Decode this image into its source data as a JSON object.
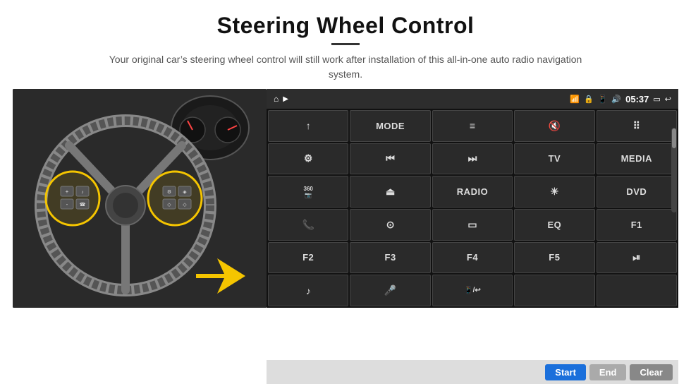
{
  "header": {
    "title": "Steering Wheel Control",
    "subtitle": "Your original car’s steering wheel control will still work after installation of this all-in-one auto radio navigation system."
  },
  "status_bar": {
    "icon_home": "⌂",
    "icon_wifi": "▲",
    "icon_lock": "🔒",
    "icon_sim": "📶",
    "icon_bt": "✿",
    "time": "05:37",
    "icon_screen": "□",
    "icon_back": "↩"
  },
  "buttons": [
    {
      "id": "b1",
      "type": "icon",
      "icon": "↑",
      "label": "nav-up"
    },
    {
      "id": "b2",
      "type": "text",
      "text": "MODE"
    },
    {
      "id": "b3",
      "type": "icon",
      "icon": "☰",
      "label": "menu"
    },
    {
      "id": "b4",
      "type": "icon",
      "icon": "🔇",
      "label": "mute"
    },
    {
      "id": "b5",
      "type": "icon",
      "icon": "…",
      "label": "apps"
    },
    {
      "id": "b6",
      "type": "icon",
      "icon": "⚙",
      "label": "settings"
    },
    {
      "id": "b7",
      "type": "icon",
      "icon": "⏮",
      "label": "prev"
    },
    {
      "id": "b8",
      "type": "icon",
      "icon": "⏭",
      "label": "next"
    },
    {
      "id": "b9",
      "type": "text",
      "text": "TV"
    },
    {
      "id": "b10",
      "type": "text",
      "text": "MEDIA"
    },
    {
      "id": "b11",
      "type": "icon",
      "icon": "📷",
      "label": "360cam"
    },
    {
      "id": "b12",
      "type": "icon",
      "icon": "⏫",
      "label": "eject"
    },
    {
      "id": "b13",
      "type": "text",
      "text": "RADIO"
    },
    {
      "id": "b14",
      "type": "icon",
      "icon": "☀",
      "label": "brightness"
    },
    {
      "id": "b15",
      "type": "text",
      "text": "DVD"
    },
    {
      "id": "b16",
      "type": "icon",
      "icon": "📞",
      "label": "phone"
    },
    {
      "id": "b17",
      "type": "icon",
      "icon": "☉",
      "label": "navi"
    },
    {
      "id": "b18",
      "type": "icon",
      "icon": "▭",
      "label": "mirror"
    },
    {
      "id": "b19",
      "type": "text",
      "text": "EQ"
    },
    {
      "id": "b20",
      "type": "text",
      "text": "F1"
    },
    {
      "id": "b21",
      "type": "text",
      "text": "F2"
    },
    {
      "id": "b22",
      "type": "text",
      "text": "F3"
    },
    {
      "id": "b23",
      "type": "text",
      "text": "F4"
    },
    {
      "id": "b24",
      "type": "text",
      "text": "F5"
    },
    {
      "id": "b25",
      "type": "icon",
      "icon": "⏯",
      "label": "play-pause"
    },
    {
      "id": "b26",
      "type": "icon",
      "icon": "♫",
      "label": "music"
    },
    {
      "id": "b27",
      "type": "icon",
      "icon": "🎤",
      "label": "mic"
    },
    {
      "id": "b28",
      "type": "icon",
      "icon": "📱",
      "label": "phone-call"
    },
    {
      "id": "b29",
      "type": "empty",
      "text": ""
    },
    {
      "id": "b30",
      "type": "empty",
      "text": ""
    }
  ],
  "action_bar": {
    "start_label": "Start",
    "end_label": "End",
    "clear_label": "Clear"
  }
}
